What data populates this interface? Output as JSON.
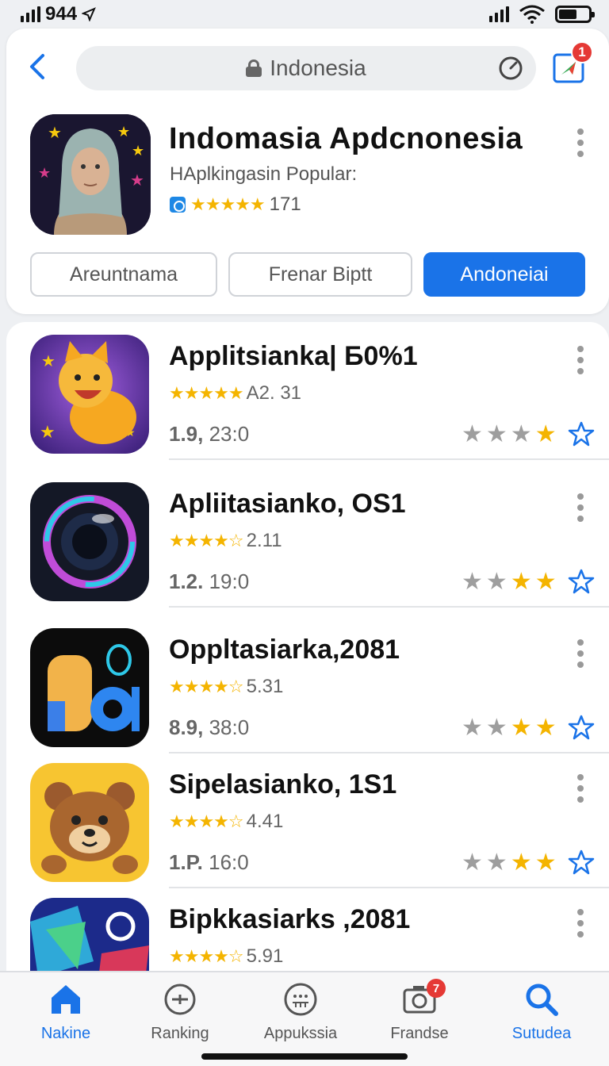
{
  "status_bar": {
    "time": "944",
    "signal_icon": "signal-bars-icon",
    "location_icon": "location-arrow-icon"
  },
  "browser": {
    "url_text": "Indonesia",
    "notification_count": "1"
  },
  "hero": {
    "title": "Indomasia Apdcnonesia",
    "subtitle": "HAplkingasin  Popular:",
    "rating_stars": "★★★★★",
    "rating_count": "171"
  },
  "chips": [
    {
      "label": "Areuntnama",
      "active": false
    },
    {
      "label": "Frenar Biptt",
      "active": false
    },
    {
      "label": "Andoneiai",
      "active": true
    }
  ],
  "apps": [
    {
      "name": "Applitsianka| Б0%1",
      "rating_stars": "★★★★★",
      "rating_text": "A2. 31",
      "meta_bold": "1.9,",
      "meta_rest": " 23:0",
      "icon": "fox-app-icon"
    },
    {
      "name": "Apliitasianko, OS1",
      "rating_stars": "★★★★☆",
      "rating_text": "2.11",
      "meta_bold": "1.2.",
      "meta_rest": " 19:0",
      "icon": "camera-lens-app-icon"
    },
    {
      "name": "Oppltasiarka,2081",
      "rating_stars": "★★★★☆",
      "rating_text": "5.31",
      "meta_bold": "8.9,",
      "meta_rest": " 38:0",
      "icon": "letter-a-app-icon"
    },
    {
      "name": "Sipelasianko, 1S1",
      "rating_stars": "★★★★☆",
      "rating_text": "4.41",
      "meta_bold": "1.P.",
      "meta_rest": " 16:0",
      "icon": "bear-app-icon"
    },
    {
      "name": "Bipkkasiarks ,2081",
      "rating_stars": "★★★★☆",
      "rating_text": "5.91",
      "meta_bold": "",
      "meta_rest": "",
      "icon": "geometric-app-icon"
    }
  ],
  "bottom_nav": [
    {
      "label": "Nakine",
      "icon": "home-icon",
      "active": true
    },
    {
      "label": "Ranking",
      "icon": "ranking-icon",
      "active": false
    },
    {
      "label": "Appukssia",
      "icon": "apps-icon",
      "active": false
    },
    {
      "label": "Frandse",
      "icon": "camera-icon",
      "active": false,
      "badge": "7"
    },
    {
      "label": "Sutudea",
      "icon": "search-icon",
      "active": true
    }
  ],
  "colors": {
    "accent": "#1a73e8",
    "star": "#f4b400",
    "badge": "#e53935"
  }
}
